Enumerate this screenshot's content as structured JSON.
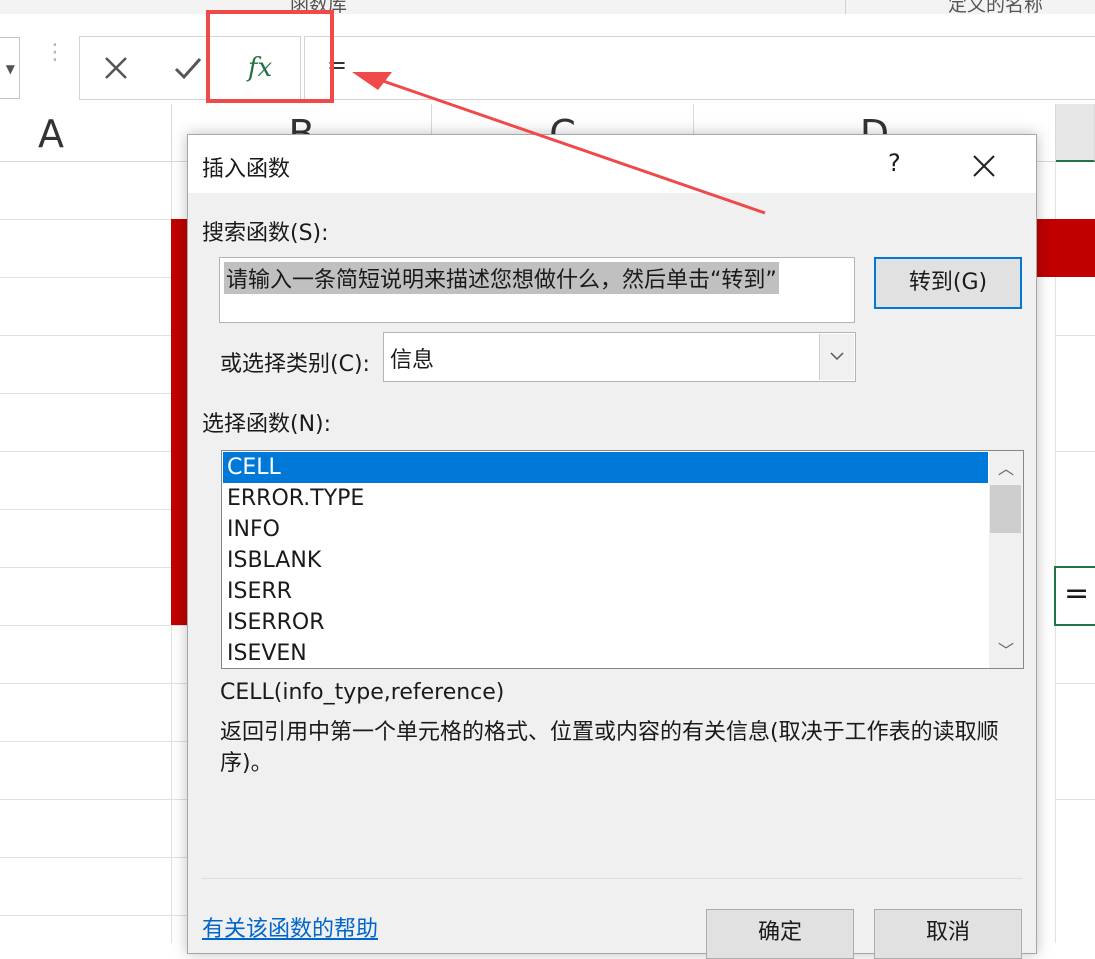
{
  "ribbon": {
    "group_left": "函数库",
    "group_right": "定义的名称"
  },
  "formula_bar": {
    "cancel_glyph": "✕",
    "enter_glyph": "✓",
    "fx_label": "fx",
    "formula_text": "="
  },
  "grid": {
    "columns": [
      "A",
      "B",
      "C",
      "D"
    ],
    "visible_cell_text": "=",
    "accent_red": "#c00000",
    "annotation_color": "#f04949"
  },
  "dialog": {
    "title": "插入函数",
    "help_glyph": "?",
    "close_glyph": "✕",
    "search_label": "搜索函数(S):",
    "search_value": "请输入一条简短说明来描述您想做什么，然后单击“转到”",
    "go_button": "转到(G)",
    "category_label": "或选择类别(C):",
    "category_value": "信息",
    "select_label": "选择函数(N):",
    "functions": [
      "CELL",
      "ERROR.TYPE",
      "INFO",
      "ISBLANK",
      "ISERR",
      "ISERROR",
      "ISEVEN"
    ],
    "selected_function": "CELL",
    "signature": "CELL(info_type,reference)",
    "description": " 返回引用中第一个单元格的格式、位置或内容的有关信息(取决于工作表的读取顺序)。",
    "help_link": "有关该函数的帮助",
    "ok_button": "确定",
    "cancel_button": "取消",
    "selection_color": "#0078d7"
  }
}
